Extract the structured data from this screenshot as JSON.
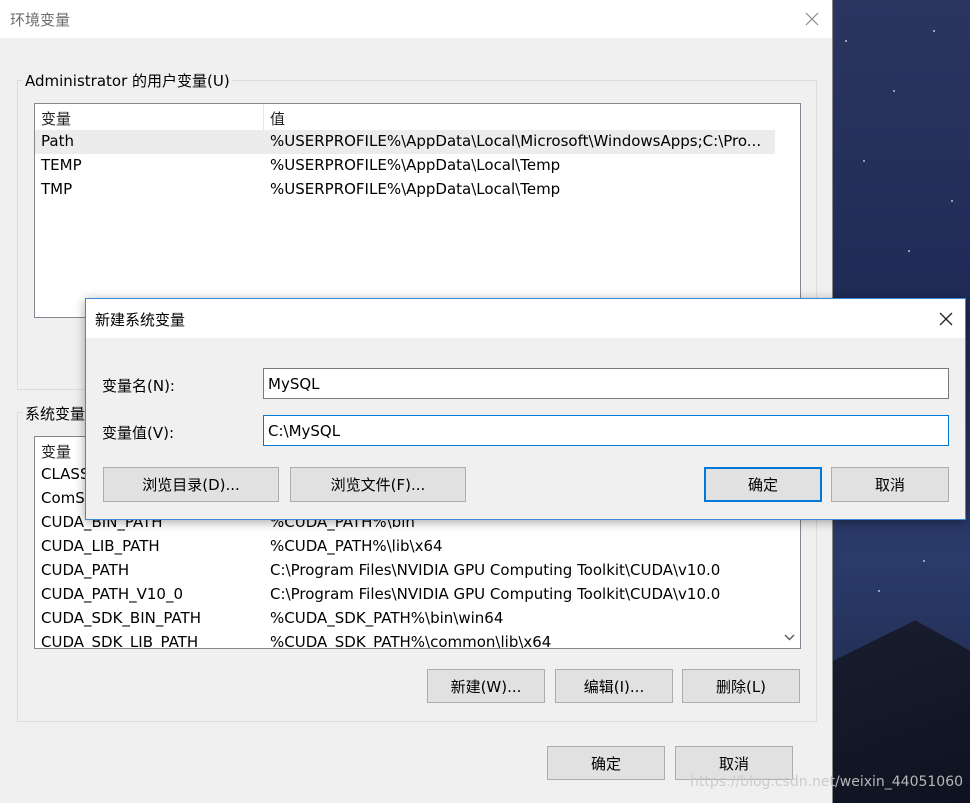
{
  "main_window": {
    "title": "环境变量",
    "user_group": {
      "label": "Administrator 的用户变量(U)",
      "columns": [
        "变量",
        "值"
      ],
      "rows": [
        {
          "name": "Path",
          "value": "%USERPROFILE%\\AppData\\Local\\Microsoft\\WindowsApps;C:\\Pro..."
        },
        {
          "name": "TEMP",
          "value": "%USERPROFILE%\\AppData\\Local\\Temp"
        },
        {
          "name": "TMP",
          "value": "%USERPROFILE%\\AppData\\Local\\Temp"
        }
      ]
    },
    "system_group": {
      "label": "系统变量",
      "columns": [
        "变量",
        "值"
      ],
      "rows": [
        {
          "name": "CLASS",
          "value": ""
        },
        {
          "name": "ComS",
          "value": ""
        },
        {
          "name": "CUDA_BIN_PATH",
          "value": "%CUDA_PATH%\\bin"
        },
        {
          "name": "CUDA_LIB_PATH",
          "value": "%CUDA_PATH%\\lib\\x64"
        },
        {
          "name": "CUDA_PATH",
          "value": "C:\\Program Files\\NVIDIA GPU Computing Toolkit\\CUDA\\v10.0"
        },
        {
          "name": "CUDA_PATH_V10_0",
          "value": "C:\\Program Files\\NVIDIA GPU Computing Toolkit\\CUDA\\v10.0"
        },
        {
          "name": "CUDA_SDK_BIN_PATH",
          "value": "%CUDA_SDK_PATH%\\bin\\win64"
        },
        {
          "name": "CUDA_SDK_LIB_PATH",
          "value": "%CUDA_SDK_PATH%\\common\\lib\\x64"
        }
      ],
      "buttons": {
        "new": "新建(W)...",
        "edit": "编辑(I)...",
        "delete": "删除(L)"
      }
    },
    "buttons": {
      "ok": "确定",
      "cancel": "取消"
    }
  },
  "dialog": {
    "title": "新建系统变量",
    "name_label": "变量名(N):",
    "name_value": "MySQL",
    "value_label": "变量值(V):",
    "value_value": "C:\\MySQL",
    "buttons": {
      "browse_dir": "浏览目录(D)...",
      "browse_file": "浏览文件(F)...",
      "ok": "确定",
      "cancel": "取消"
    }
  },
  "watermark": "https://blog.csdn.net/weixin_44051060",
  "icons": {
    "close": "close-icon",
    "scroll_down": "chevron-down-icon"
  },
  "colors": {
    "accent": "#0078d7",
    "window_bg": "#f0f0f0",
    "titlebar_bg": "#ffffff"
  }
}
